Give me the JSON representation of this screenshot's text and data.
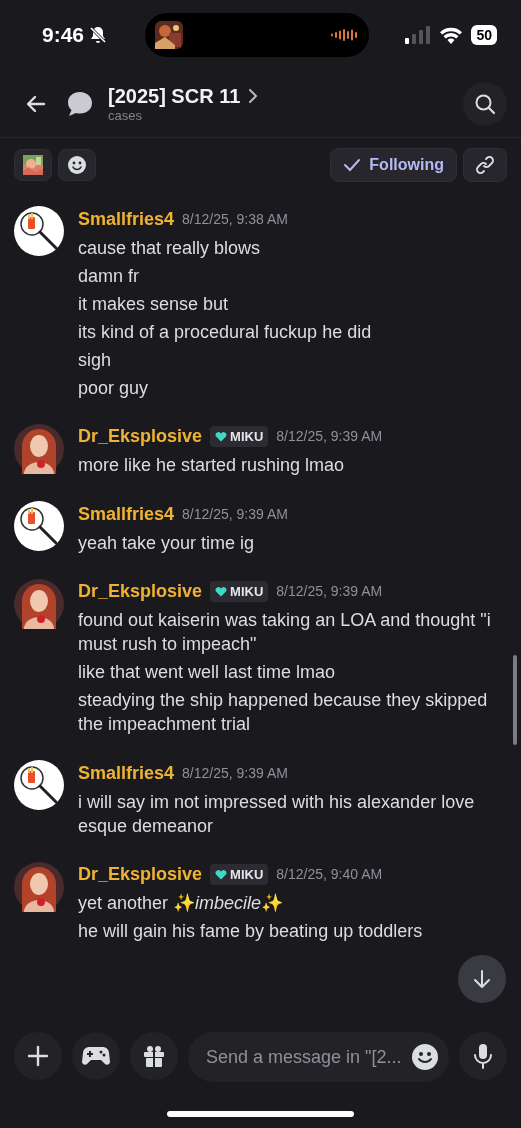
{
  "status_bar": {
    "time": "9:46",
    "battery": "50"
  },
  "header": {
    "title": "[2025] SCR 11",
    "subtitle": "cases"
  },
  "follow_button": {
    "label": "Following",
    "selected": true
  },
  "messages": [
    {
      "author": "Smallfries4",
      "avatar": {
        "kind": "magnifier"
      },
      "timestamp": "8/12/25, 9:38 AM",
      "lines": [
        "cause that really blows",
        "damn fr",
        "it makes sense but",
        "its kind of a procedural fuckup he did",
        "sigh",
        "poor guy"
      ]
    },
    {
      "author": "Dr_Eksplosive",
      "avatar": {
        "kind": "portrait"
      },
      "badge": "MIKU",
      "timestamp": "8/12/25, 9:39 AM",
      "lines": [
        "more like he started rushing lmao"
      ]
    },
    {
      "author": "Smallfries4",
      "avatar": {
        "kind": "magnifier"
      },
      "timestamp": "8/12/25, 9:39 AM",
      "lines": [
        "yeah take your time ig"
      ]
    },
    {
      "author": "Dr_Eksplosive",
      "avatar": {
        "kind": "portrait"
      },
      "badge": "MIKU",
      "timestamp": "8/12/25, 9:39 AM",
      "lines": [
        "found out kaiserin was taking an LOA and thought \"i must rush to impeach\"",
        "like that went well last time lmao",
        "steadying the ship happened because they skipped the impeachment trial"
      ]
    },
    {
      "author": "Smallfries4",
      "avatar": {
        "kind": "magnifier"
      },
      "timestamp": "8/12/25, 9:39 AM",
      "lines": [
        "i will say im not impressed with his alexander love esque demeanor"
      ]
    },
    {
      "author": "Dr_Eksplosive",
      "avatar": {
        "kind": "portrait"
      },
      "badge": "MIKU",
      "timestamp": "8/12/25, 9:40 AM",
      "lines": [
        "yet another ✨*imbecile*✨",
        "he will gain his fame by beating up toddlers"
      ]
    }
  ],
  "composer": {
    "placeholder": "Send a message in \"[2..."
  }
}
